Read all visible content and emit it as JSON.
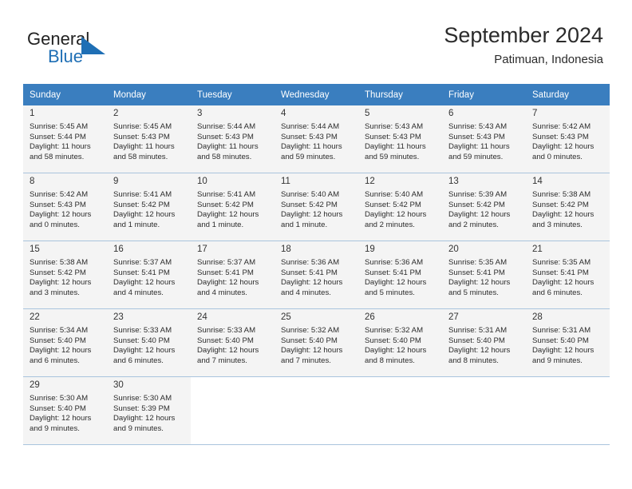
{
  "brand": {
    "name_part1": "General",
    "name_part2": "Blue",
    "logo_icon": "triangle-flag-icon"
  },
  "header": {
    "title": "September 2024",
    "subtitle": "Patimuan, Indonesia"
  },
  "colors": {
    "header_row_bg": "#3a7ebf",
    "header_row_text": "#ffffff",
    "cell_bg": "#f4f4f4",
    "cell_border": "#a9c4dd",
    "brand_blue": "#1f6fb5"
  },
  "weekdays": [
    "Sunday",
    "Monday",
    "Tuesday",
    "Wednesday",
    "Thursday",
    "Friday",
    "Saturday"
  ],
  "weeks": [
    [
      {
        "day": "1",
        "info": "Sunrise: 5:45 AM\nSunset: 5:44 PM\nDaylight: 11 hours\nand 58 minutes."
      },
      {
        "day": "2",
        "info": "Sunrise: 5:45 AM\nSunset: 5:43 PM\nDaylight: 11 hours\nand 58 minutes."
      },
      {
        "day": "3",
        "info": "Sunrise: 5:44 AM\nSunset: 5:43 PM\nDaylight: 11 hours\nand 58 minutes."
      },
      {
        "day": "4",
        "info": "Sunrise: 5:44 AM\nSunset: 5:43 PM\nDaylight: 11 hours\nand 59 minutes."
      },
      {
        "day": "5",
        "info": "Sunrise: 5:43 AM\nSunset: 5:43 PM\nDaylight: 11 hours\nand 59 minutes."
      },
      {
        "day": "6",
        "info": "Sunrise: 5:43 AM\nSunset: 5:43 PM\nDaylight: 11 hours\nand 59 minutes."
      },
      {
        "day": "7",
        "info": "Sunrise: 5:42 AM\nSunset: 5:43 PM\nDaylight: 12 hours\nand 0 minutes."
      }
    ],
    [
      {
        "day": "8",
        "info": "Sunrise: 5:42 AM\nSunset: 5:43 PM\nDaylight: 12 hours\nand 0 minutes."
      },
      {
        "day": "9",
        "info": "Sunrise: 5:41 AM\nSunset: 5:42 PM\nDaylight: 12 hours\nand 1 minute."
      },
      {
        "day": "10",
        "info": "Sunrise: 5:41 AM\nSunset: 5:42 PM\nDaylight: 12 hours\nand 1 minute."
      },
      {
        "day": "11",
        "info": "Sunrise: 5:40 AM\nSunset: 5:42 PM\nDaylight: 12 hours\nand 1 minute."
      },
      {
        "day": "12",
        "info": "Sunrise: 5:40 AM\nSunset: 5:42 PM\nDaylight: 12 hours\nand 2 minutes."
      },
      {
        "day": "13",
        "info": "Sunrise: 5:39 AM\nSunset: 5:42 PM\nDaylight: 12 hours\nand 2 minutes."
      },
      {
        "day": "14",
        "info": "Sunrise: 5:38 AM\nSunset: 5:42 PM\nDaylight: 12 hours\nand 3 minutes."
      }
    ],
    [
      {
        "day": "15",
        "info": "Sunrise: 5:38 AM\nSunset: 5:42 PM\nDaylight: 12 hours\nand 3 minutes."
      },
      {
        "day": "16",
        "info": "Sunrise: 5:37 AM\nSunset: 5:41 PM\nDaylight: 12 hours\nand 4 minutes."
      },
      {
        "day": "17",
        "info": "Sunrise: 5:37 AM\nSunset: 5:41 PM\nDaylight: 12 hours\nand 4 minutes."
      },
      {
        "day": "18",
        "info": "Sunrise: 5:36 AM\nSunset: 5:41 PM\nDaylight: 12 hours\nand 4 minutes."
      },
      {
        "day": "19",
        "info": "Sunrise: 5:36 AM\nSunset: 5:41 PM\nDaylight: 12 hours\nand 5 minutes."
      },
      {
        "day": "20",
        "info": "Sunrise: 5:35 AM\nSunset: 5:41 PM\nDaylight: 12 hours\nand 5 minutes."
      },
      {
        "day": "21",
        "info": "Sunrise: 5:35 AM\nSunset: 5:41 PM\nDaylight: 12 hours\nand 6 minutes."
      }
    ],
    [
      {
        "day": "22",
        "info": "Sunrise: 5:34 AM\nSunset: 5:40 PM\nDaylight: 12 hours\nand 6 minutes."
      },
      {
        "day": "23",
        "info": "Sunrise: 5:33 AM\nSunset: 5:40 PM\nDaylight: 12 hours\nand 6 minutes."
      },
      {
        "day": "24",
        "info": "Sunrise: 5:33 AM\nSunset: 5:40 PM\nDaylight: 12 hours\nand 7 minutes."
      },
      {
        "day": "25",
        "info": "Sunrise: 5:32 AM\nSunset: 5:40 PM\nDaylight: 12 hours\nand 7 minutes."
      },
      {
        "day": "26",
        "info": "Sunrise: 5:32 AM\nSunset: 5:40 PM\nDaylight: 12 hours\nand 8 minutes."
      },
      {
        "day": "27",
        "info": "Sunrise: 5:31 AM\nSunset: 5:40 PM\nDaylight: 12 hours\nand 8 minutes."
      },
      {
        "day": "28",
        "info": "Sunrise: 5:31 AM\nSunset: 5:40 PM\nDaylight: 12 hours\nand 9 minutes."
      }
    ],
    [
      {
        "day": "29",
        "info": "Sunrise: 5:30 AM\nSunset: 5:40 PM\nDaylight: 12 hours\nand 9 minutes."
      },
      {
        "day": "30",
        "info": "Sunrise: 5:30 AM\nSunset: 5:39 PM\nDaylight: 12 hours\nand 9 minutes."
      },
      {
        "day": "",
        "info": ""
      },
      {
        "day": "",
        "info": ""
      },
      {
        "day": "",
        "info": ""
      },
      {
        "day": "",
        "info": ""
      },
      {
        "day": "",
        "info": ""
      }
    ]
  ]
}
